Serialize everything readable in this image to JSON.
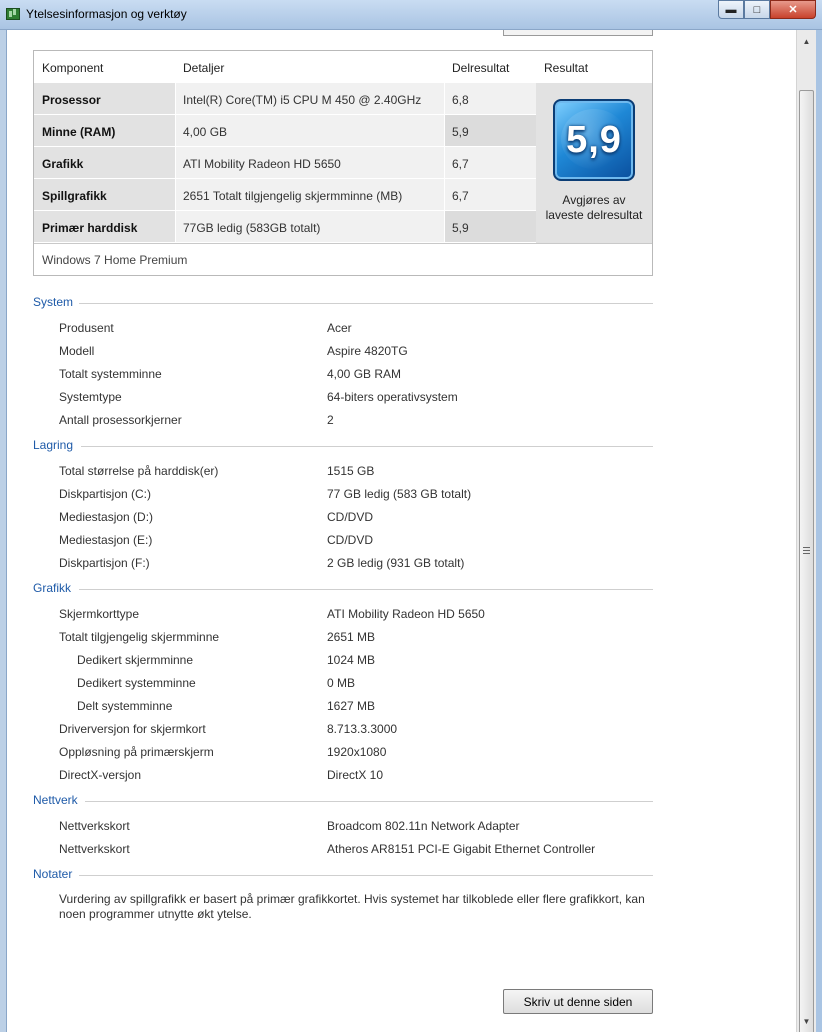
{
  "window": {
    "title": "Ytelsesinformasjon og verktøy",
    "min_icon": "minimize-icon",
    "max_icon": "maximize-icon",
    "close_icon": "close-icon"
  },
  "score_table": {
    "headers": [
      "Komponent",
      "Detaljer",
      "Delresultat",
      "Resultat"
    ],
    "rows": [
      {
        "component": "Prosessor",
        "details": "Intel(R) Core(TM) i5 CPU M 450 @ 2.40GHz",
        "subscore": "6,8"
      },
      {
        "component": "Minne (RAM)",
        "details": "4,00 GB",
        "subscore": "5,9"
      },
      {
        "component": "Grafikk",
        "details": "ATI Mobility Radeon HD 5650",
        "subscore": "6,7"
      },
      {
        "component": "Spillgrafikk",
        "details": "2651 Totalt tilgjengelig skjermminne (MB)",
        "subscore": "6,7"
      },
      {
        "component": "Primær harddisk",
        "details": "77GB ledig (583GB totalt)",
        "subscore": "5,9"
      }
    ],
    "base_score": "5,9",
    "base_score_note_1": "Avgjøres av",
    "base_score_note_2": "laveste delresultat",
    "edition": "Windows 7 Home Premium"
  },
  "system": {
    "title": "System",
    "items": [
      {
        "label": "Produsent",
        "value": "Acer"
      },
      {
        "label": "Modell",
        "value": "Aspire 4820TG"
      },
      {
        "label": "Totalt systemminne",
        "value": "4,00 GB RAM"
      },
      {
        "label": "Systemtype",
        "value": "64-biters operativsystem"
      },
      {
        "label": "Antall prosessorkjerner",
        "value": "2"
      }
    ]
  },
  "storage": {
    "title": "Lagring",
    "items": [
      {
        "label": "Total størrelse på harddisk(er)",
        "value": "1515 GB"
      },
      {
        "label": "Diskpartisjon (C:)",
        "value": "77 GB ledig (583 GB totalt)"
      },
      {
        "label": "Mediestasjon (D:)",
        "value": "CD/DVD"
      },
      {
        "label": "Mediestasjon (E:)",
        "value": "CD/DVD"
      },
      {
        "label": "Diskpartisjon (F:)",
        "value": "2 GB ledig (931 GB totalt)"
      }
    ]
  },
  "graphics": {
    "title": "Grafikk",
    "items": [
      {
        "label": "Skjermkorttype",
        "value": "ATI Mobility Radeon HD 5650"
      },
      {
        "label": "Totalt tilgjengelig skjermminne",
        "value": "2651 MB"
      },
      {
        "label": "Dedikert skjermminne",
        "value": "1024 MB"
      },
      {
        "label": "Dedikert systemminne",
        "value": "0 MB"
      },
      {
        "label": "Delt systemminne",
        "value": "1627 MB"
      },
      {
        "label": "Driverversjon for skjermkort",
        "value": "8.713.3.3000"
      },
      {
        "label": "Oppløsning på primærskjerm",
        "value": "1920x1080"
      },
      {
        "label": "DirectX-versjon",
        "value": "DirectX 10"
      }
    ]
  },
  "network": {
    "title": "Nettverk",
    "items": [
      {
        "label": "Nettverkskort",
        "value": "Broadcom 802.11n Network Adapter"
      },
      {
        "label": "Nettverkskort",
        "value": "Atheros AR8151 PCI-E Gigabit Ethernet Controller"
      }
    ]
  },
  "notes": {
    "title": "Notater",
    "text": "Vurdering av spillgrafikk er basert på primær grafikkortet. Hvis systemet har tilkoblede eller flere grafikkort, kan noen programmer utnytte økt ytelse."
  },
  "print_button": "Skriv ut denne siden"
}
